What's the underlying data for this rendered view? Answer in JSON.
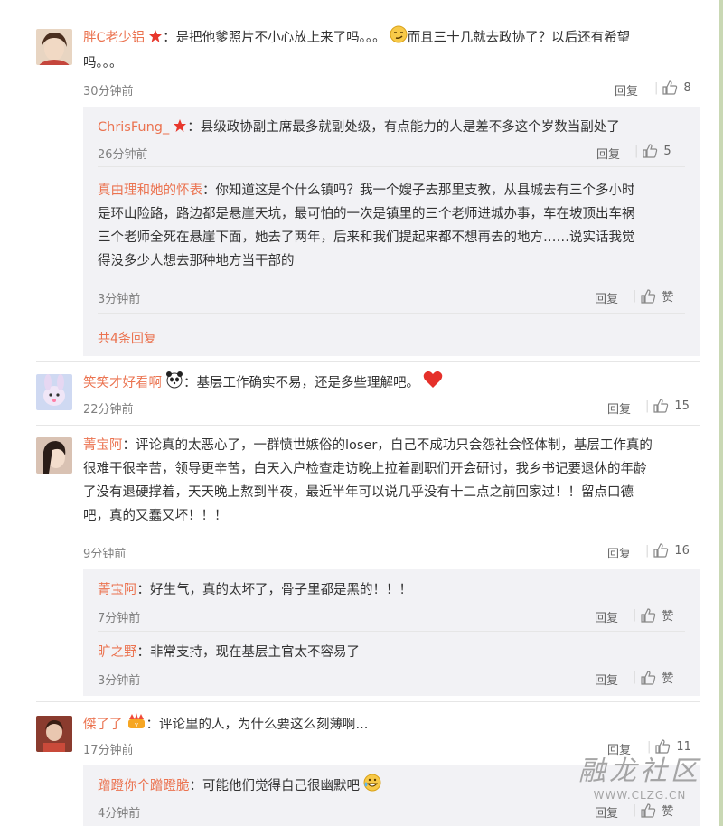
{
  "comments": [
    {
      "user": "胖C老少铝",
      "text1": "：是把他爹照片不小心放上来了吗。。。",
      "text2": "而且三十几就去政协了？以后还有希望",
      "text3": "吗。。。",
      "time": "30分钟前",
      "reply": "回复",
      "likes": "8"
    },
    {
      "user": "笑笑才好看啊",
      "text": "：基层工作确实不易，还是多些理解吧。",
      "time": "22分钟前",
      "reply": "回复",
      "likes": "15"
    },
    {
      "user": "菁宝阿",
      "lines": [
        "：评论真的太恶心了，一群愤世嫉俗的loser，自己不成功只会怨社会怪体制，基层工作真的",
        "很难干很辛苦，领导更辛苦，白天入户检查走访晚上拉着副职们开会研讨，我乡书记要退休的年龄",
        "了没有退硬撑着，天天晚上熬到半夜，最近半年可以说几乎没有十二点之前回家过！！留点口德",
        "吧，真的又蠢又坏！！！"
      ],
      "time": "9分钟前",
      "reply": "回复",
      "likes": "16"
    },
    {
      "user": "傑了了",
      "text": "：评论里的人，为什么要这么刻薄啊...",
      "time": "17分钟前",
      "reply": "回复",
      "likes": "11"
    }
  ],
  "replies": [
    {
      "user": "ChrisFung_",
      "text": "：县级政协副主席最多就副处级，有点能力的人是差不多这个岁数当副处了",
      "time": "26分钟前",
      "reply": "回复",
      "likes": "5"
    },
    {
      "user": "真由理和她的怀表",
      "lines": [
        "：你知道这是个什么镇吗？我一个嫂子去那里支教，从县城去有三个多小时",
        "是环山险路，路边都是悬崖天坑，最可怕的一次是镇里的三个老师进城办事，车在坡顶出车祸",
        "三个老师全死在悬崖下面，她去了两年，后来和我们提起来都不想再去的地方……说实话我觉",
        "得没多少人想去那种地方当干部的"
      ],
      "time": "3分钟前",
      "reply": "回复",
      "likes": "赞"
    },
    {
      "user": "菁宝阿",
      "text": "：好生气，真的太坏了，骨子里都是黑的！！！",
      "time": "7分钟前",
      "reply": "回复",
      "likes": "赞"
    },
    {
      "user": "旷之野",
      "text": "：非常支持，现在基层主官太不容易了",
      "time": "3分钟前",
      "reply": "回复",
      "likes": "赞"
    },
    {
      "user": "蹭蹬你个蹭蹬脆",
      "text": "：可能他们觉得自己很幽默吧",
      "time": "4分钟前",
      "reply": "回复",
      "likes": "赞"
    }
  ],
  "more_replies": "共4条回复",
  "watermark": {
    "title": "融龙社区",
    "url": "WWW.CLZG.CN"
  },
  "colors": {
    "username": "#eb7350",
    "time": "#808080",
    "subbox": "#f2f2f5"
  }
}
